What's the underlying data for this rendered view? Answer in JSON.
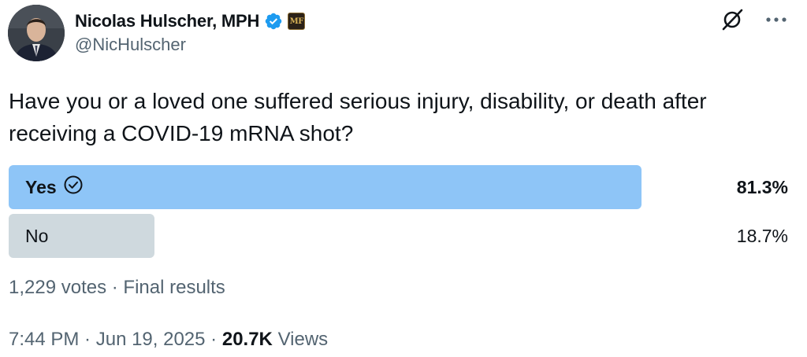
{
  "author": {
    "display_name": "Nicolas Hulscher, MPH",
    "handle": "@NicHulscher",
    "verified_badge": "verified-badge-icon",
    "affiliation_badge": "MF"
  },
  "post": {
    "text": "Have you or a loved one suffered serious injury, disability, or death after receiving a COVID-19 mRNA shot?"
  },
  "poll": {
    "options": [
      {
        "label": "Yes",
        "percent_text": "81.3%",
        "percent": 81.3,
        "winner": true,
        "bar_color": "#8ec5f7"
      },
      {
        "label": "No",
        "percent_text": "18.7%",
        "percent": 18.7,
        "winner": false,
        "bar_color": "#cfd9de"
      }
    ],
    "votes": "1,229 votes",
    "separator": " · ",
    "status": "Final results"
  },
  "footer": {
    "time": "7:44 PM",
    "date": "Jun 19, 2025",
    "separator": " · ",
    "views_count": "20.7K",
    "views_label": "Views"
  },
  "colors": {
    "text_primary": "#0f1419",
    "text_secondary": "#536471",
    "verified_blue": "#1d9bf0",
    "winner_bar": "#8ec5f7",
    "other_bar": "#cfd9de"
  },
  "icons": [
    "grok-icon",
    "more-icon",
    "check-circle-icon"
  ]
}
